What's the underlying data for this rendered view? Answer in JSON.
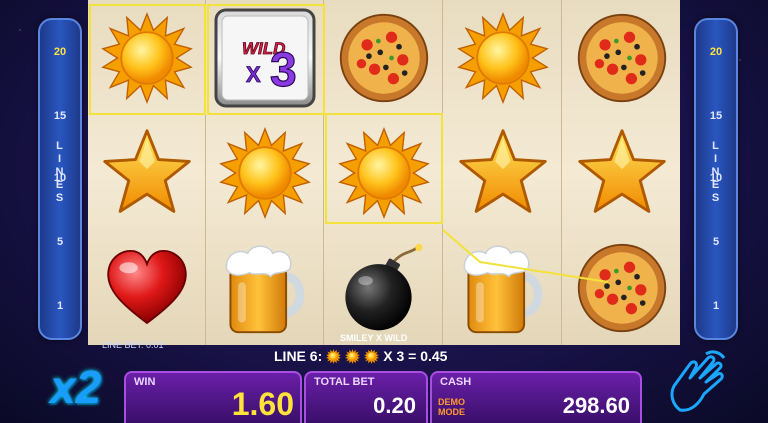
{
  "lines_panel": {
    "label": "LINES",
    "numbers": [
      "20",
      "15",
      "10",
      "5",
      "1"
    ],
    "active": "20"
  },
  "reels": [
    [
      "sun",
      "star",
      "heart"
    ],
    [
      "wild-x3",
      "sun",
      "beer"
    ],
    [
      "pizza",
      "sun",
      "bomb"
    ],
    [
      "sun",
      "star",
      "beer"
    ],
    [
      "pizza",
      "star",
      "pizza"
    ]
  ],
  "wild_symbol": {
    "line1": "WILD",
    "line2": "X",
    "multiplier": "3"
  },
  "line_bet": "LINE BET: 0.01",
  "multiplier": "x2",
  "win_line": {
    "combo_label": "SMILEY X WILD",
    "line_label": "LINE 6:",
    "payout": "X 3 = 0.45"
  },
  "win": {
    "label": "WIN",
    "value": "1.60"
  },
  "total_bet": {
    "label": "TOTAL BET",
    "value": "0.20"
  },
  "cash": {
    "label": "CASH",
    "value": "298.60",
    "mode_line1": "DEMO",
    "mode_line2": "MODE"
  },
  "colors": {
    "win_highlight": "#f2e23a",
    "win_value": "#ffe23a",
    "multiplier": "#1a9cff"
  }
}
